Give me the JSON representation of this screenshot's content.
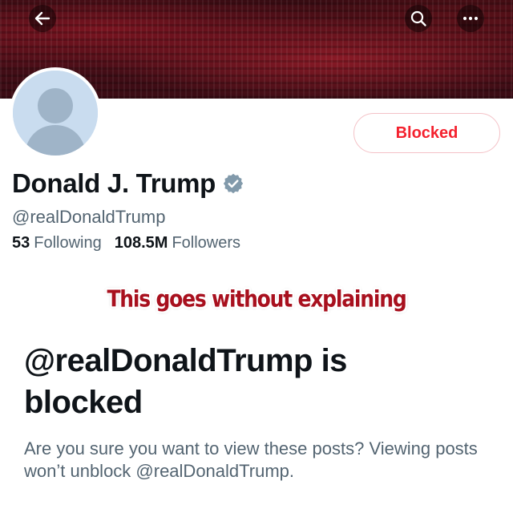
{
  "header": {
    "back_icon": "arrow-left-icon",
    "search_icon": "search-icon",
    "more_icon": "more-horizontal-icon"
  },
  "profile": {
    "display_name": "Donald J. Trump",
    "verified_icon": "verified-badge-icon",
    "handle": "@realDonaldTrump",
    "following_count": "53",
    "following_label": "Following",
    "followers_count": "108.5M",
    "followers_label": "Followers"
  },
  "actions": {
    "blocked_label": "Blocked"
  },
  "overlay": {
    "caption": "This goes without explaining"
  },
  "blocked_notice": {
    "title": "@realDonaldTrump is blocked",
    "description": "Are you sure you want to view these posts? Viewing posts won’t unblock @realDonaldTrump."
  },
  "colors": {
    "blocked_red": "#f4212e",
    "blocked_border": "#f4c2c7",
    "text_primary": "#0f1419",
    "text_secondary": "#536471",
    "verified": "#829aab",
    "caption_red": "#a8101e"
  }
}
